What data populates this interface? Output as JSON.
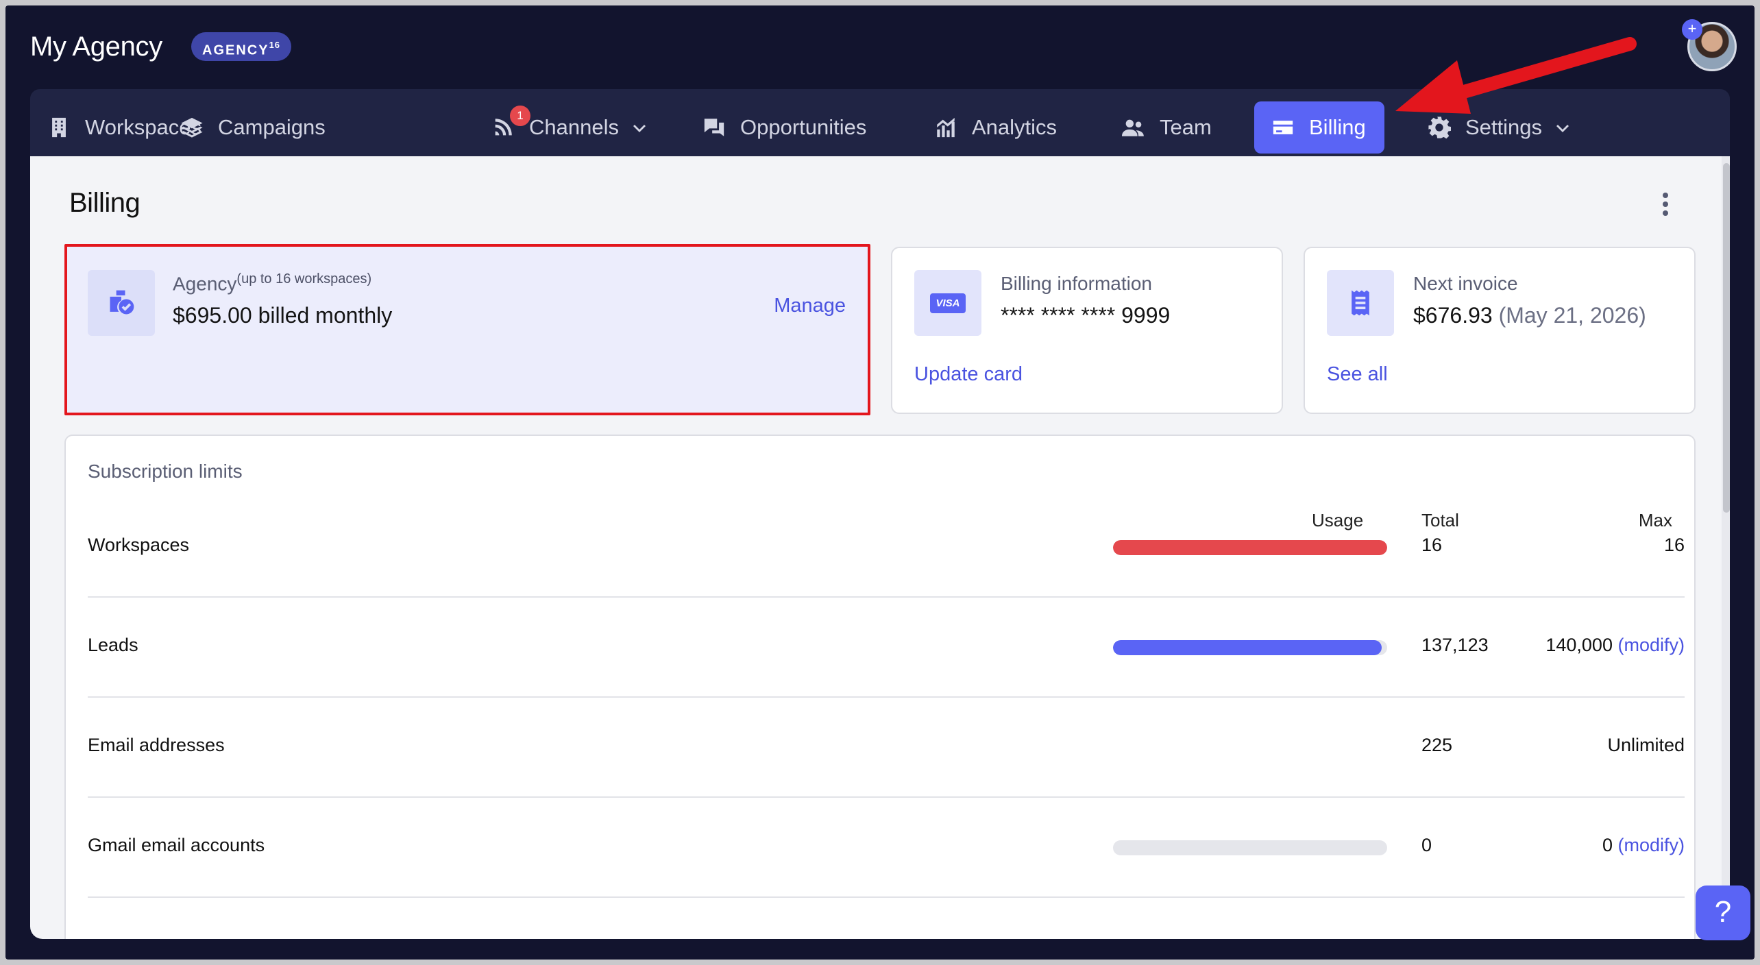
{
  "header": {
    "brand": "My Agency",
    "plan_badge": "AGENCY",
    "plan_badge_sup": "16",
    "avatar_plus": "+"
  },
  "nav": {
    "items": [
      {
        "label": "Workspaces",
        "icon": "building-icon"
      },
      {
        "label": "Campaigns",
        "icon": "layers-icon"
      },
      {
        "label": "Channels",
        "icon": "rss-icon",
        "badge": "1",
        "has_caret": true
      },
      {
        "label": "Opportunities",
        "icon": "chat-bubbles-icon"
      },
      {
        "label": "Analytics",
        "icon": "chart-icon"
      },
      {
        "label": "Team",
        "icon": "users-icon"
      },
      {
        "label": "Billing",
        "icon": "credit-card-icon",
        "active": true
      },
      {
        "label": "Settings",
        "icon": "gear-icon",
        "has_caret": true
      }
    ]
  },
  "page": {
    "title": "Billing"
  },
  "plan_card": {
    "label": "Agency",
    "label_sup": "(up to 16 workspaces)",
    "value": "$695.00 billed monthly",
    "manage_label": "Manage"
  },
  "billing_card": {
    "label": "Billing information",
    "icon_text": "VISA",
    "value": "**** **** **** 9999",
    "link": "Update card"
  },
  "invoice_card": {
    "label": "Next invoice",
    "amount": "$676.93",
    "date": "(May 21, 2026)",
    "link": "See all"
  },
  "limits": {
    "title": "Subscription limits",
    "columns": {
      "usage": "Usage",
      "total": "Total",
      "max": "Max"
    },
    "rows": [
      {
        "label": "Workspaces",
        "usage_fraction": 1.0,
        "bar_color": "#e5484d",
        "total": "16",
        "max": "16",
        "modify": ""
      },
      {
        "label": "Leads",
        "usage_fraction": 0.979,
        "bar_color": "#5a64f5",
        "total": "137,123",
        "max": "140,000",
        "modify": "(modify)"
      },
      {
        "label": "Email addresses",
        "usage_fraction": null,
        "total": "225",
        "max": "Unlimited",
        "modify": ""
      },
      {
        "label": "Gmail email accounts",
        "usage_fraction": 0,
        "bar_color": "#5a64f5",
        "total": "0",
        "max": "0",
        "modify": "(modify)"
      }
    ]
  },
  "help_button": "?",
  "colors": {
    "accent": "#5a64f5",
    "danger": "#e5484d",
    "dark_bg": "#12142e",
    "annotation_red": "#e3161d"
  }
}
